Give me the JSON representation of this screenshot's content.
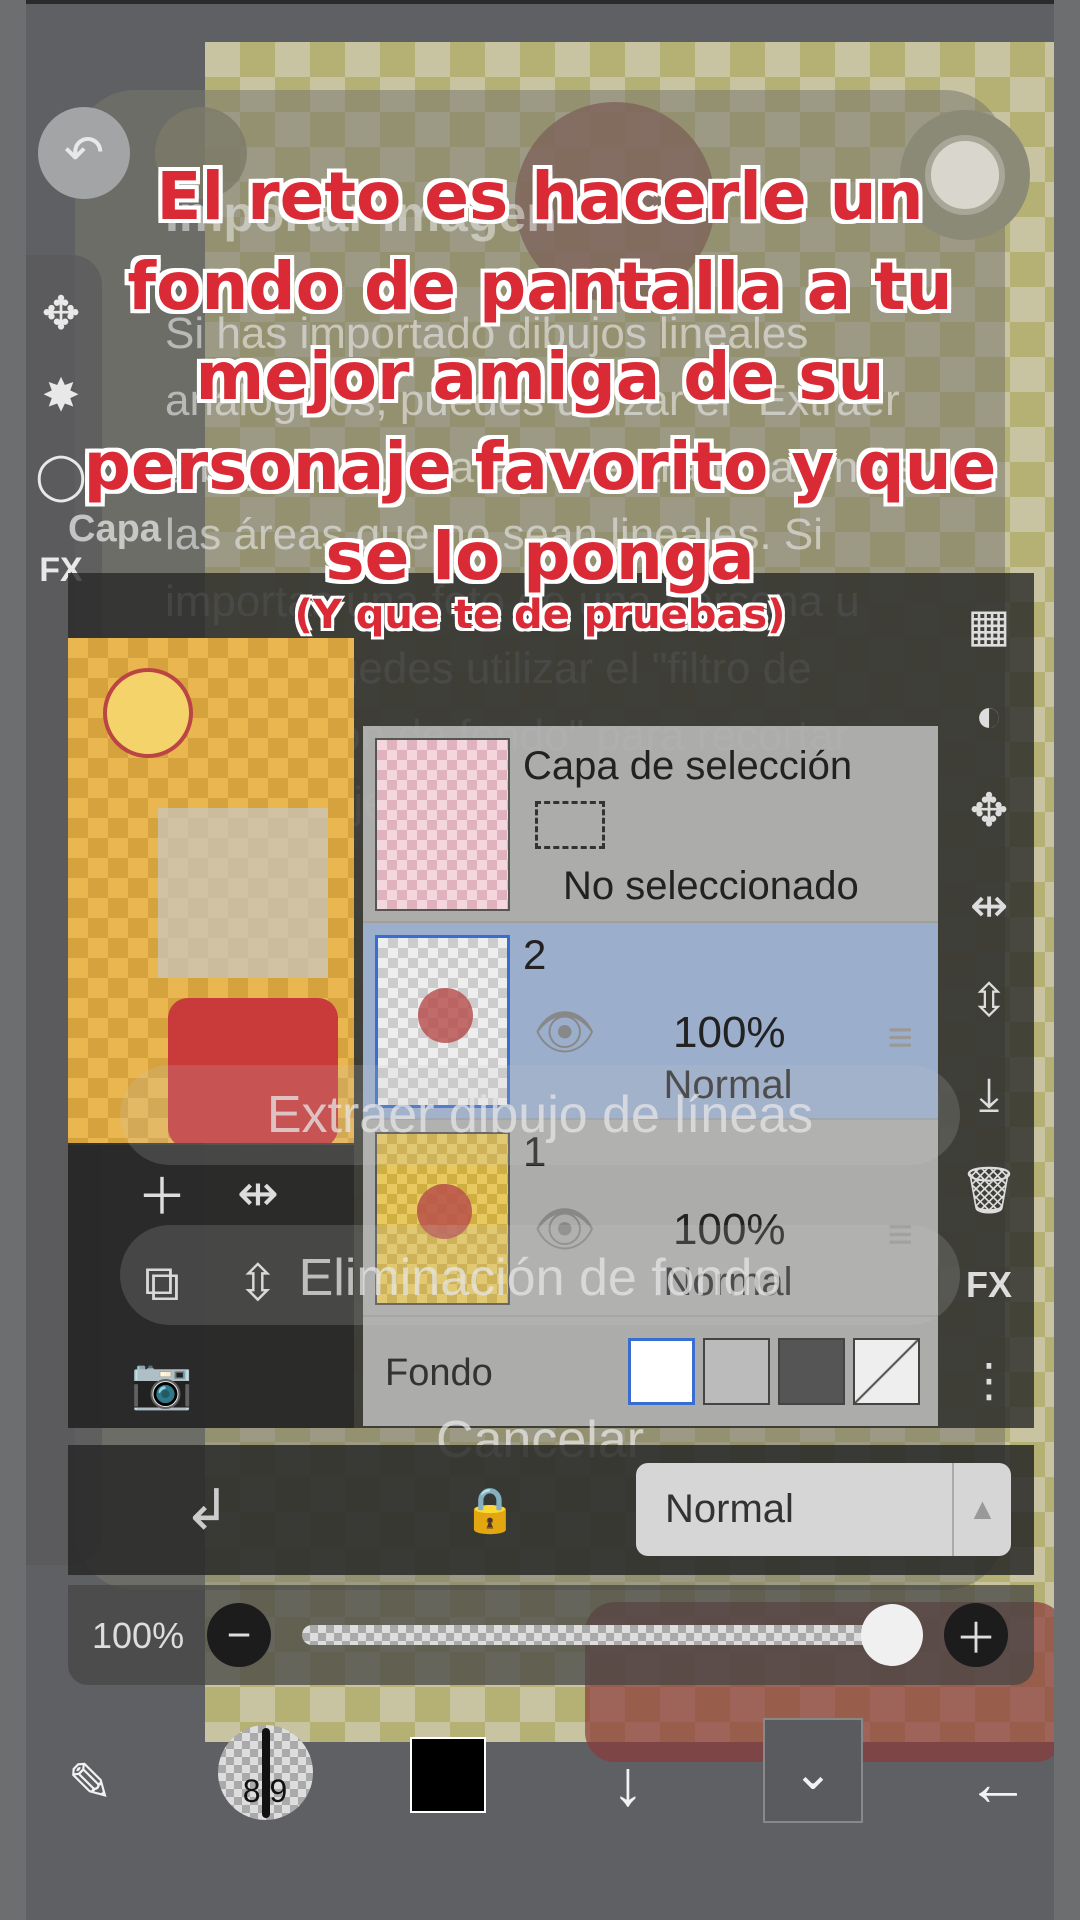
{
  "caption": {
    "main": "El reto es hacerle un fondo de pantalla a tu mejor amiga de su personaje favorito y que se lo ponga",
    "sub": "(Y que te de pruebas)"
  },
  "dialog": {
    "title": "Importar imagen",
    "body": "Si has importado dibujos lineales analógicos, puedes utilizar el \"Extraer dibujo lineal\" para hacer transparentes las áreas que no sean lineales. Si importas una foto de una persona u objeto, puedes utilizar el \"filtro de eliminación de fondo\" para recortar solo el objeto.",
    "options": [
      "Extraer dibujo de líneas",
      "Eliminación de fondo",
      "Cancelar"
    ]
  },
  "layers_panel": {
    "title": "Capa",
    "rows": [
      {
        "name": "Capa de selección",
        "sub": "No seleccionado"
      },
      {
        "name": "2",
        "opacity": "100%",
        "blend": "Normal"
      },
      {
        "name": "1",
        "opacity": "100%",
        "blend": "Normal"
      }
    ],
    "background_label": "Fondo"
  },
  "blend_mode": {
    "value": "Normal"
  },
  "opacity_slider": {
    "label": "100%",
    "value_percent": 100
  },
  "brush": {
    "size": "8.9"
  },
  "icons": {
    "back": "undo-icon",
    "fx": "FX"
  },
  "colors": {
    "caption": "#d92a35",
    "caption_outline": "#ffffff",
    "current_color": "#000000",
    "selected_layer": "#96afd7"
  }
}
